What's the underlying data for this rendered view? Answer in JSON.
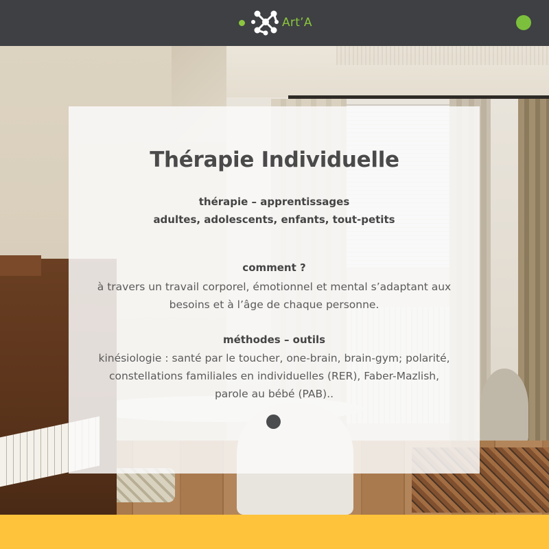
{
  "header": {
    "logo_text": "Art’A",
    "logo_color": "#8cc63f",
    "bar_color": "#3e4043",
    "menu_dot_color": "#7cbf3c"
  },
  "card": {
    "title": "Thérapie Individuelle",
    "subtitle_line1": "thérapie – apprentissages",
    "subtitle_line2": "adultes, adolescents, enfants, tout-petits",
    "section1_heading": "comment ?",
    "section1_text": "à travers un travail corporel, émotionnel et mental s’adaptant aux besoins et à l’âge de chaque personne.",
    "section2_heading": "méthodes – outils",
    "section2_text": "kinésiologie : santé par le toucher, one-brain, brain-gym; polarité, constellations familiales en individuelles (RER), Faber-Mazlish, parole au bébé (PAB).."
  },
  "footer": {
    "band_color": "#fec33b"
  }
}
